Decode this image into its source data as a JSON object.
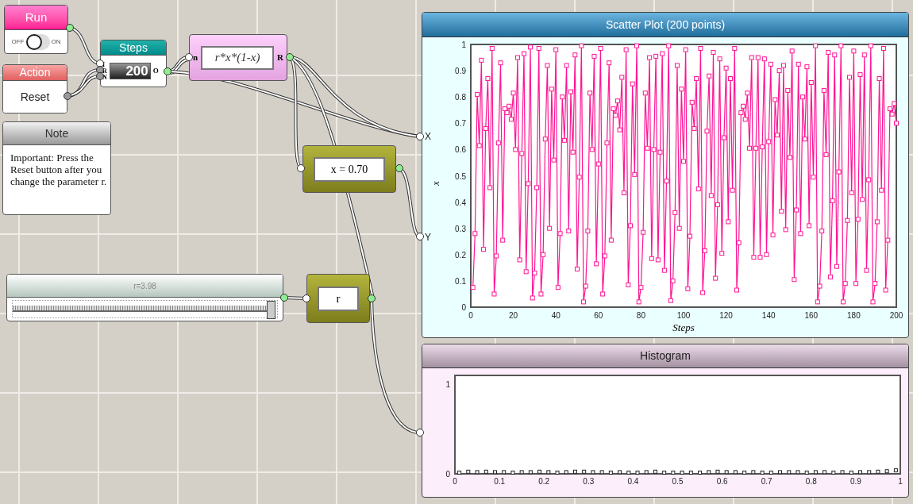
{
  "run_node": {
    "title": "Run",
    "toggle": {
      "off_label": "OFF",
      "on_label": "ON",
      "on": false
    }
  },
  "action_node": {
    "title": "Action",
    "button": "Reset"
  },
  "steps_node": {
    "title": "Steps",
    "ports": [
      "I",
      "R",
      "N"
    ],
    "value": "200",
    "output_port": "O"
  },
  "formula_node": {
    "input_port": "n",
    "expression": "r*x*(1-x)",
    "output_port": "R"
  },
  "note": {
    "title": "Note",
    "text": "Important: Press the Reset button after you change the parameter r."
  },
  "value_node": {
    "text": "x = 0.70"
  },
  "slider": {
    "label": "r=3.98",
    "level": 0.995
  },
  "r_node": {
    "text": "r"
  },
  "scatter_panel": {
    "title": "Scatter Plot (200 points)",
    "ports": [
      "X",
      "Y"
    ],
    "chart_data": {
      "type": "line",
      "xlabel": "Steps",
      "ylabel": "x",
      "xlim": [
        0,
        200
      ],
      "ylim": [
        0,
        1
      ],
      "xticks": [
        0,
        20,
        40,
        60,
        80,
        100,
        120,
        140,
        160,
        180,
        200
      ],
      "yticks": [
        0,
        0.1,
        0.2,
        0.3,
        0.4,
        0.5,
        0.6,
        0.7,
        0.8,
        0.9,
        1
      ],
      "x": [
        1,
        2,
        3,
        4,
        5,
        6,
        7,
        8,
        9,
        10,
        11,
        12,
        13,
        14,
        15,
        16,
        17,
        18,
        19,
        20,
        21,
        22,
        23,
        24,
        25,
        26,
        27,
        28,
        29,
        30,
        31,
        32,
        33,
        34,
        35,
        36,
        37,
        38,
        39,
        40,
        41,
        42,
        43,
        44,
        45,
        46,
        47,
        48,
        49,
        50,
        51,
        52,
        53,
        54,
        55,
        56,
        57,
        58,
        59,
        60,
        61,
        62,
        63,
        64,
        65,
        66,
        67,
        68,
        69,
        70,
        71,
        72,
        73,
        74,
        75,
        76,
        77,
        78,
        79,
        80,
        81,
        82,
        83,
        84,
        85,
        86,
        87,
        88,
        89,
        90,
        91,
        92,
        93,
        94,
        95,
        96,
        97,
        98,
        99,
        100,
        101,
        102,
        103,
        104,
        105,
        106,
        107,
        108,
        109,
        110,
        111,
        112,
        113,
        114,
        115,
        116,
        117,
        118,
        119,
        120,
        121,
        122,
        123,
        124,
        125,
        126,
        127,
        128,
        129,
        130,
        131,
        132,
        133,
        134,
        135,
        136,
        137,
        138,
        139,
        140,
        141,
        142,
        143,
        144,
        145,
        146,
        147,
        148,
        149,
        150,
        151,
        152,
        153,
        154,
        155,
        156,
        157,
        158,
        159,
        160,
        161,
        162,
        163,
        164,
        165,
        166,
        167,
        168,
        169,
        170,
        171,
        172,
        173,
        174,
        175,
        176,
        177,
        178,
        179,
        180,
        181,
        182,
        183,
        184,
        185,
        186,
        187,
        188,
        189,
        190,
        191,
        192,
        193,
        194,
        195,
        196,
        197,
        198,
        199,
        200
      ],
      "series": [
        {
          "color": "#ff1493",
          "marker": "square",
          "values": [
            0.075,
            0.28,
            0.81,
            0.615,
            0.94,
            0.22,
            0.68,
            0.87,
            0.455,
            0.985,
            0.05,
            0.195,
            0.625,
            0.93,
            0.255,
            0.755,
            0.74,
            0.765,
            0.715,
            0.815,
            0.6,
            0.95,
            0.18,
            0.585,
            0.965,
            0.135,
            0.47,
            0.99,
            0.035,
            0.13,
            0.455,
            0.985,
            0.05,
            0.2,
            0.64,
            0.92,
            0.3,
            0.83,
            0.56,
            0.98,
            0.075,
            0.28,
            0.8,
            0.635,
            0.92,
            0.29,
            0.82,
            0.59,
            0.96,
            0.145,
            0.495,
            0.995,
            0.02,
            0.08,
            0.29,
            0.815,
            0.6,
            0.955,
            0.165,
            0.545,
            0.985,
            0.05,
            0.195,
            0.625,
            0.93,
            0.255,
            0.755,
            0.73,
            0.785,
            0.675,
            0.875,
            0.435,
            0.98,
            0.085,
            0.31,
            0.85,
            0.505,
            0.995,
            0.02,
            0.075,
            0.285,
            0.815,
            0.605,
            0.95,
            0.185,
            0.6,
            0.955,
            0.18,
            0.59,
            0.965,
            0.14,
            0.48,
            0.995,
            0.025,
            0.1,
            0.36,
            0.92,
            0.3,
            0.83,
            0.555,
            0.98,
            0.07,
            0.27,
            0.78,
            0.68,
            0.87,
            0.45,
            0.985,
            0.055,
            0.215,
            0.67,
            0.88,
            0.425,
            0.97,
            0.11,
            0.39,
            0.945,
            0.205,
            0.645,
            0.91,
            0.325,
            0.87,
            0.445,
            0.985,
            0.065,
            0.245,
            0.74,
            0.765,
            0.715,
            0.815,
            0.605,
            0.95,
            0.19,
            0.605,
            0.95,
            0.19,
            0.61,
            0.945,
            0.2,
            0.63,
            0.925,
            0.275,
            0.79,
            0.655,
            0.9,
            0.365,
            0.92,
            0.295,
            0.825,
            0.57,
            0.975,
            0.105,
            0.37,
            0.925,
            0.28,
            0.8,
            0.64,
            0.915,
            0.31,
            0.855,
            0.495,
            0.995,
            0.02,
            0.08,
            0.29,
            0.825,
            0.58,
            0.97,
            0.115,
            0.405,
            0.96,
            0.155,
            0.515,
            0.995,
            0.02,
            0.09,
            0.33,
            0.875,
            0.435,
            0.975,
            0.09,
            0.335,
            0.885,
            0.41,
            0.96,
            0.14,
            0.485,
            0.995,
            0.02,
            0.09,
            0.325,
            0.87,
            0.445,
            0.985,
            0.065,
            0.255,
            0.755,
            0.735,
            0.775,
            0.7
          ]
        }
      ]
    }
  },
  "histogram_panel": {
    "title": "Histogram",
    "chart_data": {
      "type": "scatter",
      "xlim": [
        0,
        1
      ],
      "ylim": [
        0,
        1.1
      ],
      "xticks": [
        0,
        0.1,
        0.2,
        0.3,
        0.4,
        0.5,
        0.6,
        0.7,
        0.8,
        0.9,
        1
      ],
      "yticks": [
        0,
        1
      ],
      "x": [
        0.01,
        0.03,
        0.05,
        0.07,
        0.09,
        0.11,
        0.13,
        0.15,
        0.17,
        0.19,
        0.21,
        0.23,
        0.25,
        0.27,
        0.29,
        0.31,
        0.33,
        0.35,
        0.37,
        0.39,
        0.41,
        0.43,
        0.45,
        0.47,
        0.49,
        0.51,
        0.53,
        0.55,
        0.57,
        0.59,
        0.61,
        0.63,
        0.65,
        0.67,
        0.69,
        0.71,
        0.73,
        0.75,
        0.77,
        0.79,
        0.81,
        0.83,
        0.85,
        0.87,
        0.89,
        0.91,
        0.93,
        0.95,
        0.97,
        0.99
      ],
      "series": [
        {
          "color": "#222222",
          "values": [
            0.005,
            0.015,
            0.01,
            0.015,
            0.01,
            0.01,
            0.005,
            0.01,
            0.01,
            0.015,
            0.01,
            0.005,
            0.01,
            0.015,
            0.015,
            0.01,
            0.01,
            0.005,
            0.01,
            0.005,
            0.005,
            0.01,
            0.015,
            0.005,
            0.005,
            0.005,
            0.005,
            0.005,
            0.01,
            0.015,
            0.01,
            0.01,
            0.005,
            0.01,
            0.005,
            0.005,
            0.01,
            0.01,
            0.01,
            0.005,
            0.01,
            0.01,
            0.005,
            0.01,
            0.005,
            0.01,
            0.01,
            0.015,
            0.02,
            0.03
          ]
        }
      ]
    }
  }
}
